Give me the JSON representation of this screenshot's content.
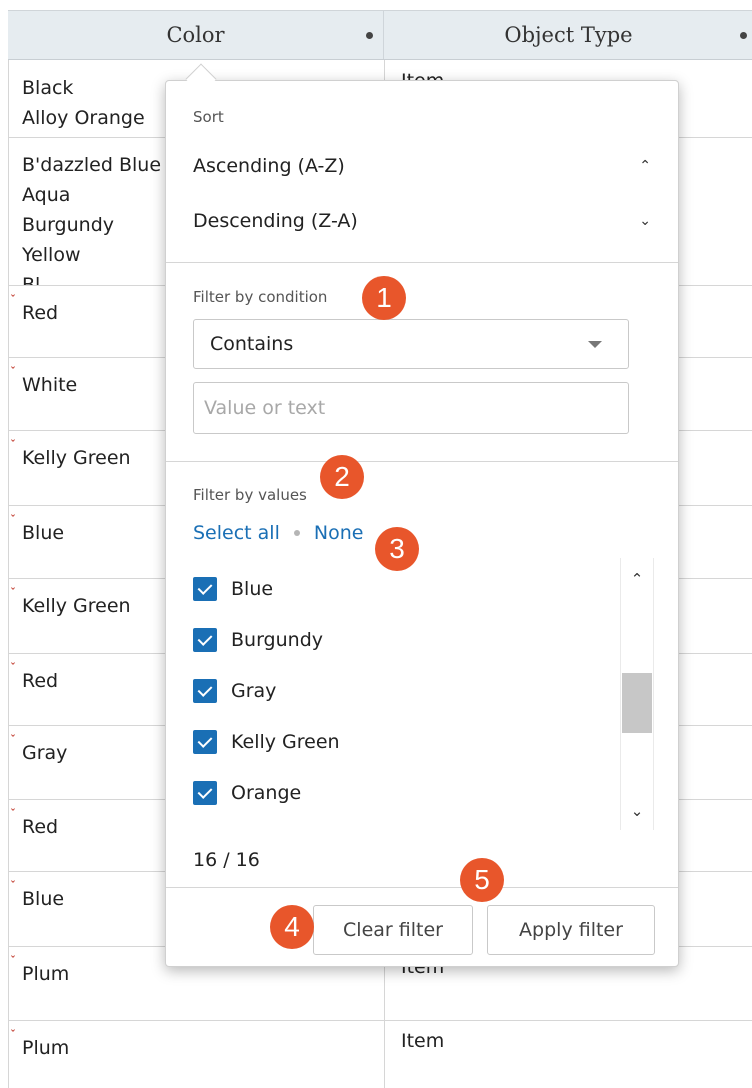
{
  "grid": {
    "columns": [
      {
        "label": "Color"
      },
      {
        "label": "Object Type"
      }
    ],
    "rows": [
      {
        "color": [
          "Black",
          "Alloy Orange"
        ],
        "type": "Item",
        "flag": false
      },
      {
        "color": [
          "B'dazzled Blue",
          "Aqua",
          "Burgundy",
          "Yellow",
          "Bl..."
        ],
        "type": "",
        "flag": false
      },
      {
        "color": [
          "Red"
        ],
        "type": "",
        "flag": true
      },
      {
        "color": [
          "White"
        ],
        "type": "",
        "flag": true
      },
      {
        "color": [
          "Kelly Green"
        ],
        "type": "",
        "flag": true
      },
      {
        "color": [
          "Blue"
        ],
        "type": "",
        "flag": true
      },
      {
        "color": [
          "Kelly Green"
        ],
        "type": "",
        "flag": true
      },
      {
        "color": [
          "Red"
        ],
        "type": "",
        "flag": true
      },
      {
        "color": [
          "Gray"
        ],
        "type": "",
        "flag": true
      },
      {
        "color": [
          "Red"
        ],
        "type": "",
        "flag": true
      },
      {
        "color": [
          "Blue"
        ],
        "type": "",
        "flag": true
      },
      {
        "color": [
          "Plum"
        ],
        "type": "Item",
        "flag": true
      },
      {
        "color": [
          "Plum"
        ],
        "type": "Item",
        "flag": true
      }
    ]
  },
  "popup": {
    "sort_label": "Sort",
    "sort_ascending": "Ascending (A-Z)",
    "sort_descending": "Descending (Z-A)",
    "filter_condition_label": "Filter by condition",
    "condition_value": "Contains",
    "value_placeholder": "Value or text",
    "filter_values_label": "Filter by values",
    "select_all": "Select all",
    "select_none": "None",
    "values": [
      {
        "label": "Blue",
        "checked": true
      },
      {
        "label": "Burgundy",
        "checked": true
      },
      {
        "label": "Gray",
        "checked": true
      },
      {
        "label": "Kelly Green",
        "checked": true
      },
      {
        "label": "Orange",
        "checked": true
      }
    ],
    "count": "16 / 16",
    "clear_filter": "Clear filter",
    "apply_filter": "Apply filter"
  },
  "badges": [
    "1",
    "2",
    "3",
    "4",
    "5"
  ],
  "colors": {
    "accent": "#1a6fb5",
    "badge": "#e8562b",
    "header_bg": "#e6ecf0",
    "flag": "#c0392b"
  }
}
